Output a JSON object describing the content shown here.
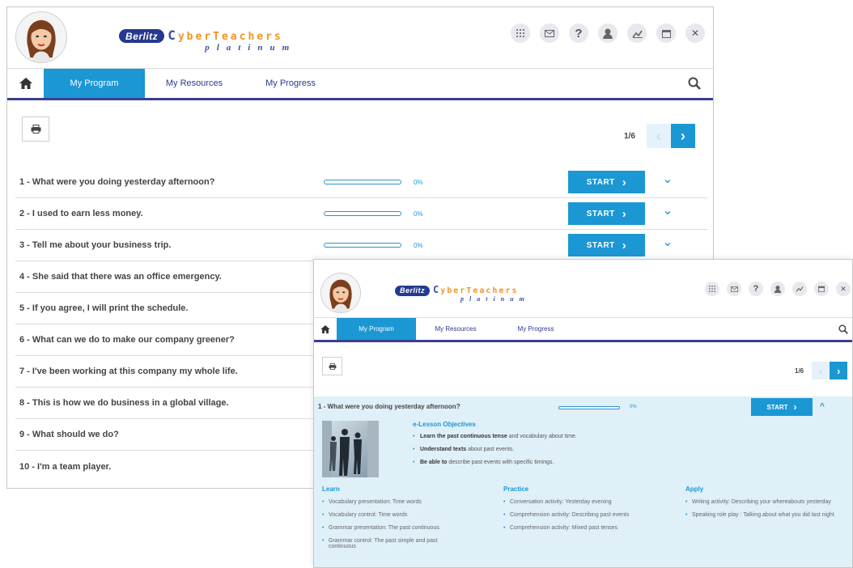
{
  "brand": {
    "berlitz": "Berlitz",
    "cyber_c": "C",
    "cyber_rest": "yberTeachers",
    "platinum": "platinum"
  },
  "header_icons": [
    "apps-grid-icon",
    "mail-icon",
    "help-icon",
    "tutor-icon",
    "progress-chart-icon",
    "calendar-icon",
    "close-icon"
  ],
  "help_glyph": "?",
  "close_glyph": "✕",
  "nav": {
    "tabs": [
      "My Program",
      "My Resources",
      "My Progress"
    ],
    "active_index": 0
  },
  "pager": {
    "count": "1/6",
    "prev_glyph": "‹",
    "next_glyph": "›"
  },
  "lessons": [
    {
      "title": "1 - What were you doing yesterday afternoon?",
      "progress": 0,
      "pct": "0%",
      "action": "START",
      "chevron": "⌄"
    },
    {
      "title": "2 - I used to earn less money.",
      "progress": 0,
      "pct": "0%",
      "action": "START",
      "chevron": "⌄"
    },
    {
      "title": "3 - Tell me about your business trip.",
      "progress": 0,
      "pct": "0%",
      "action": "START",
      "chevron": "⌄"
    },
    {
      "title": "4 - She said that there was an office emergency."
    },
    {
      "title": "5 - If you agree, I will print the schedule."
    },
    {
      "title": "6 - What can we do to make our company greener?"
    },
    {
      "title": "7 - I've been working at this company my whole life."
    },
    {
      "title": "8 - This is how we do business in a global village."
    },
    {
      "title": "9 - What should we do?"
    },
    {
      "title": "10 - I'm a team player."
    }
  ],
  "start_arrow": "›",
  "expanded": {
    "title": "1 - What were you doing yesterday afternoon?",
    "progress": 0,
    "pct": "0%",
    "action": "START",
    "chevron": "^",
    "objectives_title": "e-Lesson Objectives",
    "objectives": [
      {
        "bold": "Learn the past continuous tense",
        "rest": " and vocabulary about time."
      },
      {
        "bold": "Understand texts",
        "rest": " about past events."
      },
      {
        "bold": "Be able to",
        "rest": " describe past events with specific timings."
      }
    ],
    "columns": [
      {
        "heading": "Learn",
        "items": [
          "Vocabulary presentation: Time words",
          "Vocabulary control: Time words",
          "Grammar presentation: The past continuous",
          "Grammar control: The past simple and past continuous"
        ]
      },
      {
        "heading": "Practice",
        "items": [
          "Conversation activity: Yesterday evening",
          "Comprehension activity: Describing past events",
          "Comprehension activity: Mixed past tenses"
        ]
      },
      {
        "heading": "Apply",
        "items": [
          "Writing activity: Describing your whereabouts yesterday",
          "Speaking role play : Talking about what you did last night"
        ]
      }
    ]
  },
  "colors": {
    "accent": "#1b97d4",
    "nav_underline": "#3b3f8f",
    "brand_blue": "#253a8e",
    "brand_orange": "#f19425",
    "expanded_bg": "#dff0f8"
  }
}
